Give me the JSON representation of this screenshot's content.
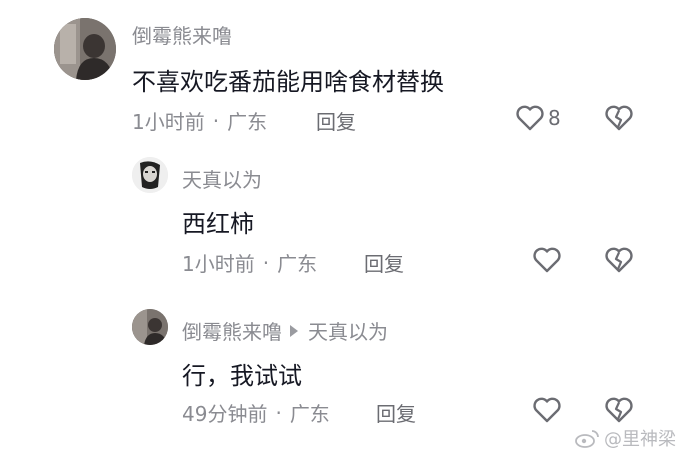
{
  "comments": [
    {
      "username": "倒霉熊来噜",
      "text": "不喜欢吃番茄能用啥食材替换",
      "time": "1小时前",
      "location": "广东",
      "reply_label": "回复",
      "likes": "8"
    },
    {
      "username": "天真以为",
      "text": "西红柿",
      "time": "1小时前",
      "location": "广东",
      "reply_label": "回复"
    },
    {
      "username": "倒霉熊来噜",
      "reply_to": "天真以为",
      "text": "行，我试试",
      "time": "49分钟前",
      "location": "广东",
      "reply_label": "回复"
    }
  ],
  "separator": "·",
  "watermark": {
    "text": "@里神梁",
    "icon": "weibo-icon"
  },
  "icons": {
    "like": "heart-outline-icon",
    "dislike": "broken-heart-icon",
    "reply_arrow": "triangle-right-icon"
  },
  "colors": {
    "text_primary": "#161823",
    "text_secondary": "#8a8b91",
    "icon_stroke": "#6b6c72",
    "watermark": "#b9babe"
  }
}
